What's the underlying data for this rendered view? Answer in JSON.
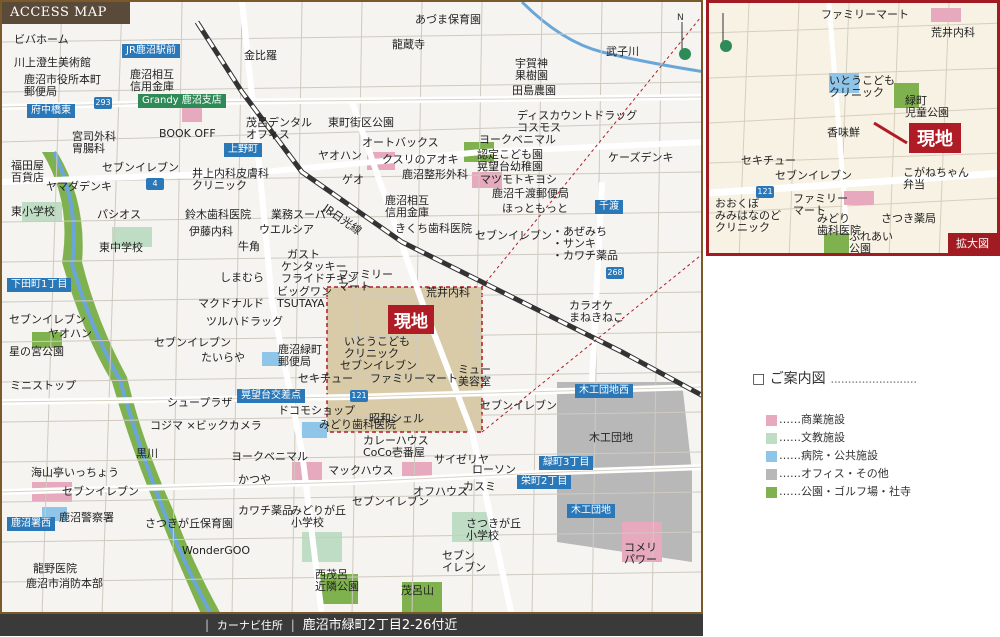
{
  "title": "ACCESS MAP",
  "genchi": "現地",
  "inset_tag": "拡大図",
  "footer": {
    "label": "カーナビ住所",
    "address": "鹿沼市緑町2丁目2-26付近"
  },
  "legend": {
    "title": "ご案内図",
    "items": [
      {
        "label": "……商業施設",
        "color": "#e6a9bd"
      },
      {
        "label": "……文教施設",
        "color": "#bfdcc4"
      },
      {
        "label": "……病院・公共施設",
        "color": "#8fc5e8"
      },
      {
        "label": "……オフィス・その他",
        "color": "#b8b8b8"
      },
      {
        "label": "……公園・ゴルフ場・社寺",
        "color": "#7fb24e"
      }
    ]
  },
  "stations": {
    "kanuma_ekimae": "JR鹿沼駅前",
    "fuchu": "府中橋東",
    "uenomachi": "上野町",
    "shimotamachi": "下田町1丁目",
    "kobodai": "晃望台交差点",
    "senba": "千渡",
    "mokko_west": "木工団地西",
    "midori3": "緑町3丁目",
    "sakae2": "栄町2丁目",
    "mokko_entrance": "木工団地",
    "kanuma_shonishi": "鹿沼署西"
  },
  "labels": {
    "bivahome": "ビバホーム",
    "kawakami": "川上澄生美術館",
    "kanuma_post": "鹿沼市役所本町\n郵便局",
    "kanuma_bank": "鹿沼相互\n信用金庫",
    "grandy": "Grandy 鹿沼支店",
    "kinpira": "金比羅",
    "azuma": "あづま保育園",
    "ryuzoji": "龍蔵寺",
    "ugajin": "宇賀神\n果樹園",
    "tajima": "田島農園",
    "musashi": "武子川",
    "miyaji": "宮司外科\n胃腸科",
    "bookoff": "BOOK OFF",
    "shigeru": "茂呂デンタル\nオフィス",
    "tohoku": "東町街区公園",
    "autobacs": "オートバックス",
    "discount": "ディスカウントドラッグ\nコスモス",
    "yorkbenimaru1": "ヨークベニマル",
    "nintei": "認定こども園\n晃望台幼稚園",
    "kudiri": "クスリのアオキ",
    "yaohan1": "ヤオハン",
    "kdenki": "ケーズデンキ",
    "fukudaya": "福田屋\n百貨店",
    "seven1": "セブンイレブン",
    "yamada": "ヤマダデンキ",
    "inoue": "井上内科皮膚科\nクリニック",
    "geo": "ゲオ",
    "kanuma_seikei": "鹿沼整形外科",
    "matsumoto": "マツモトキヨシ",
    "senba_post": "鹿沼千渡郵便局",
    "hotto": "ほっともっと",
    "higashi_sho": "東小学校",
    "pasios": "パシオス",
    "suzuki": "鈴木歯科医院",
    "gyomu": "業務スーパー",
    "kanuma_bank2": "鹿沼相互\n信用金庫",
    "kikuchi": "きくち歯科医院",
    "seven2": "セブンイレブン",
    "azemichi": "・あぜみち\n・サンキ\n・カワチ薬品",
    "higashi_chu": "東中学校",
    "ito": "伊藤内科",
    "welcia": "ウエルシア",
    "jr_nikko": "JR日光線",
    "gyukaku": "牛角",
    "gust": "ガスト",
    "shimamura": "しまむら",
    "kfc": "ケンタッキー\nフライドチキン",
    "famima1": "ファミリー\nマート",
    "arai1": "荒井内科",
    "bigone": "ビッグワン\nTSUTAYA",
    "karaoke": "カラオケ\nまねきねこ",
    "mcd": "マクドナルド",
    "tsuruha": "ツルハドラッグ",
    "seven3": "セブンイレブン",
    "yaohan2": "ヤオハン",
    "seven4": "セブンイレブン",
    "ito_kodomo": "いとうこども\nクリニック",
    "hoshinomiya": "星の宮公園",
    "taiyaya": "たいらや",
    "midori_post": "鹿沼緑町\n郵便局",
    "seven5": "セブンイレブン",
    "ministop": "ミニストップ",
    "sekichu1": "セキチュー",
    "famima2": "ファミリーマート",
    "myu": "ミュー\n美容室",
    "shoe": "シュープラザ",
    "docomo": "ドコモショップ",
    "showa": "昭和シェル",
    "seven6": "セブンイレブン",
    "kojima": "コジマ ×ビックカメラ",
    "midori_dental": "みどり歯科医院",
    "mokko_danchi": "木工団地",
    "curryhouse": "カレーハウス\nCoCo壱番屋",
    "kurokawa": "黒川",
    "yorkbenimaru2": "ヨークベニマル",
    "saizeriya": "サイゼリヤ",
    "lawson": "ローソン",
    "umiyamatei": "海山亭いっちょう",
    "mac_house": "マックハウス",
    "katsuya": "かつや",
    "seven7": "セブンイレブン",
    "offhouse": "オフハウス",
    "kasumi": "カスミ",
    "seven8": "セブンイレブン",
    "kawachi2": "カワチ薬品",
    "midorigaoka": "みどりが丘\n小学校",
    "satsukigaoka_sho": "さつきが丘\n小学校",
    "kanuma_police": "鹿沼警察署",
    "satsuki_hoiku": "さつきが丘保育園",
    "wondergoo": "WonderGOO",
    "seven9": "セブン\nイレブン",
    "komeri": "コメリ\nパワー",
    "ryuno": "龍野医院",
    "shobo": "鹿沼市消防本部",
    "nishi_moro": "西茂呂\n近隣公園",
    "moroyama": "茂呂山"
  },
  "inset_labels": {
    "famima_top": "ファミリーマート",
    "arai": "荒井内科",
    "ito_clinic": "いとうこども\nクリニック",
    "midori_park": "緑町\n児童公園",
    "koumisen": "香味鮮",
    "sekichu": "セキチュー",
    "seven": "セブンイレブン",
    "koganechan": "こがねちゃん\n弁当",
    "ookubo": "おおくぼ\nみみはなのど\nクリニック",
    "famima_bottom": "ファミリー\nマート",
    "midori_dental": "みどり\n歯科医院",
    "satsuki": "さつき薬局",
    "fureai": "ふれあい\n公園",
    "route121": "121"
  },
  "routes": {
    "r293": "293",
    "r4": "4",
    "r268": "268",
    "r121": "121"
  }
}
